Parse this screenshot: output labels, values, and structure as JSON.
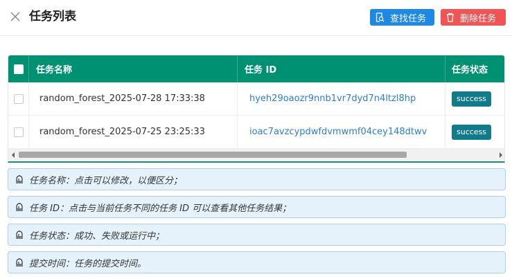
{
  "header": {
    "title": "任务列表",
    "search_label": "查找任务",
    "delete_label": "删除任务"
  },
  "colors": {
    "table_header": "#009172",
    "search_button": "#1e88e5",
    "delete_button": "#f05454",
    "status_badge": "#117a8b",
    "note_background": "#e5f2fc",
    "note_border": "#a9d0ee",
    "link": "#2d7dd2"
  },
  "table": {
    "columns": [
      "任务名称",
      "任务 ID",
      "任务状态"
    ],
    "rows": [
      {
        "name": "random_forest_2025-07-28 17:33:38",
        "id": "hyeh29oaozr9nnb1vr7dyd7n4ltzl8hp",
        "status": "success"
      },
      {
        "name": "random_forest_2025-07-25 23:25:33",
        "id": "ioac7avzcypdwfdvmwmf04cey148dtwv",
        "status": "success"
      }
    ]
  },
  "notes": [
    "任务名称：点击可以修改，以便区分；",
    "任务 ID：点击与当前任务不同的任务 ID 可以查看其他任务结果；",
    "任务状态：成功、失败或运行中；",
    "提交时间：任务的提交时间。"
  ],
  "icons": {
    "close": "close-icon",
    "search": "search-document-icon",
    "delete": "trash-icon",
    "note": "alarm-bell-icon"
  }
}
